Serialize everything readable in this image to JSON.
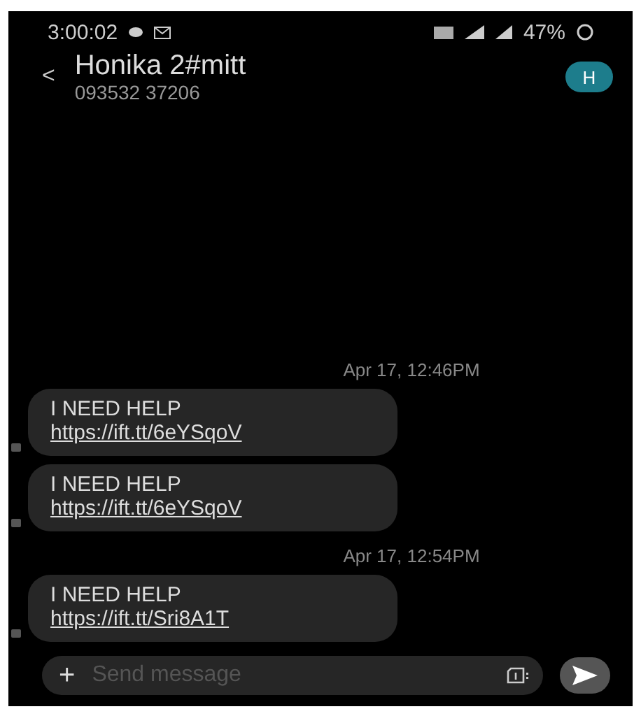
{
  "status_bar": {
    "time": "3:00:02",
    "battery": "47%"
  },
  "header": {
    "back": "<",
    "name": "Honika 2#mitt",
    "number": "093532 37206",
    "avatar": "H"
  },
  "thread": [
    {
      "kind": "timestamp",
      "text": "Apr 17, 12:46PM"
    },
    {
      "kind": "message",
      "text": "I NEED HELP",
      "link": "https://ift.tt/6eYSqoV"
    },
    {
      "kind": "message",
      "text": "I NEED HELP",
      "link": "https://ift.tt/6eYSqoV"
    },
    {
      "kind": "timestamp",
      "text": "Apr 17, 12:54PM"
    },
    {
      "kind": "message",
      "text": "I NEED HELP",
      "link": "https://ift.tt/Sri8A1T"
    }
  ],
  "composer": {
    "plus": "+",
    "placeholder": "Send message"
  }
}
